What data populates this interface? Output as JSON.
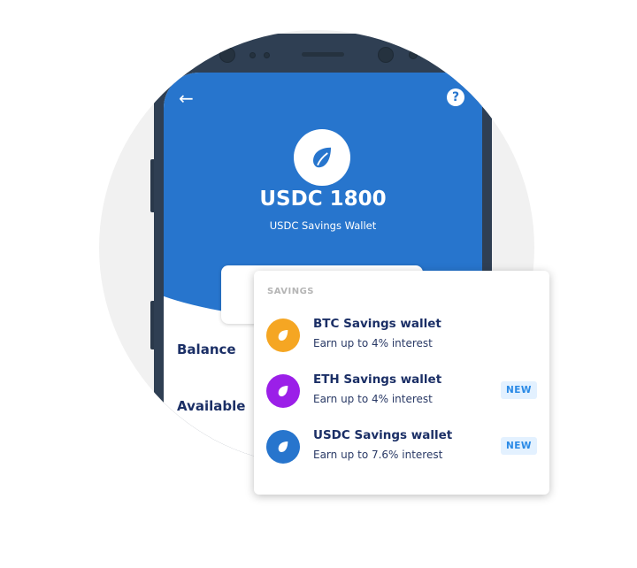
{
  "header": {
    "back_icon": "arrow-left-icon",
    "help_icon": "question-circle-icon",
    "amount": "USDC 1800",
    "subtitle": "USDC Savings Wallet",
    "logo_icon": "leaf-icon"
  },
  "body": {
    "balance_label": "Balance",
    "available_label": "Available"
  },
  "savings": {
    "title": "SAVINGS",
    "items": [
      {
        "title": "BTC Savings wallet",
        "subtitle": "Earn up to 4% interest",
        "color": "#f5a623",
        "badge": ""
      },
      {
        "title": "ETH Savings wallet",
        "subtitle": "Earn up to 4% interest",
        "color": "#9b1fe8",
        "badge": "NEW"
      },
      {
        "title": "USDC Savings wallet",
        "subtitle": "Earn up to 7.6% interest",
        "color": "#2775cd",
        "badge": "NEW"
      }
    ]
  },
  "colors": {
    "primary": "#2775cd",
    "text": "#1b2f66"
  }
}
